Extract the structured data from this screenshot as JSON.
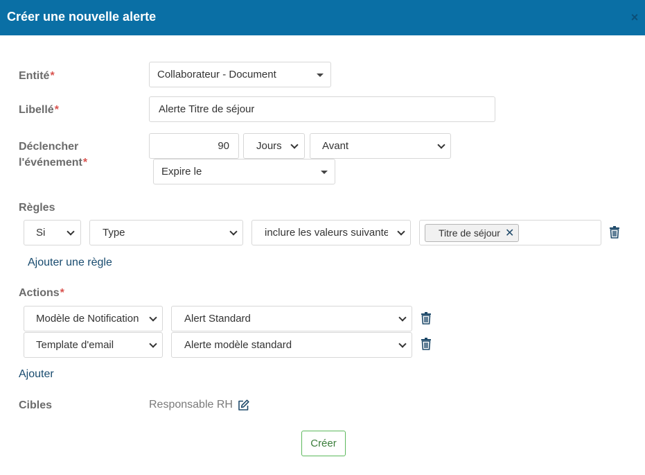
{
  "dialog": {
    "title": "Créer une nouvelle alerte",
    "close_glyph": "×"
  },
  "form": {
    "entity": {
      "label": "Entité",
      "required_mark": "*",
      "value": "Collaborateur - Document"
    },
    "libelle": {
      "label": "Libellé",
      "required_mark": "*",
      "value": "Alerte Titre de séjour"
    },
    "trigger": {
      "label_line1": "Déclencher",
      "label_line2": "l'événement",
      "required_mark": "*",
      "amount": "90",
      "unit": "Jours",
      "direction": "Avant",
      "event": "Expire le"
    },
    "rules": {
      "label": "Règles",
      "items": [
        {
          "condition": "Si",
          "field": "Type",
          "operator": "inclure les valeurs suivante",
          "tags": [
            "Titre de séjour"
          ]
        }
      ],
      "add_label": "Ajouter une règle"
    },
    "actions": {
      "label": "Actions",
      "required_mark": "*",
      "items": [
        {
          "type": "Modèle de Notification",
          "value": "Alert Standard"
        },
        {
          "type": "Template d'email",
          "value": "Alerte modèle standard"
        }
      ],
      "add_label": "Ajouter"
    },
    "targets": {
      "label": "Cibles",
      "value": "Responsable RH"
    },
    "submit_label": "Créer"
  },
  "colors": {
    "header_bg": "#0a6fa5",
    "required": "#d9534f",
    "link": "#174a6e",
    "submit_border": "#5cb85c"
  },
  "icons": {
    "close": "close-icon",
    "trash": "trash-icon",
    "edit": "edit-icon",
    "tag_remove": "x-icon"
  }
}
